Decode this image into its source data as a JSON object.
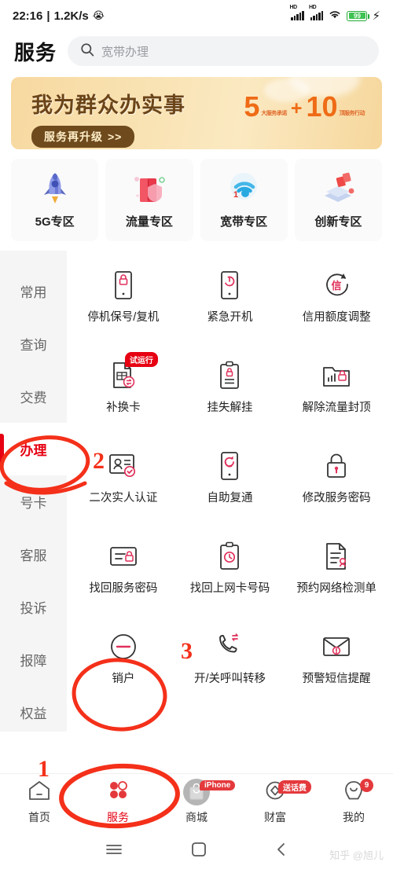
{
  "status_bar": {
    "time": "22:16",
    "separator": "|",
    "net_speed": "1.2K/s",
    "alarm_icon": "alarm-emoji-icon",
    "signal_label": "HD",
    "battery_percent": "99",
    "wifi_icon": "wifi-icon",
    "charging_icon": "lightning-bolt-icon"
  },
  "header": {
    "title": "服务",
    "search": {
      "placeholder": "宽带办理",
      "icon": "search-icon"
    }
  },
  "banner": {
    "title": "我为群众办实事",
    "button_label": "服务再升级",
    "button_arrow": ">>",
    "num_left": "5",
    "plus": "+",
    "num_right": "10",
    "sub_left": "大服务承诺",
    "sub_right": "顶服务行动"
  },
  "zones": [
    {
      "label": "5G专区",
      "icon": "rocket-icon"
    },
    {
      "label": "流量专区",
      "icon": "data-package-icon"
    },
    {
      "label": "宽带专区",
      "icon": "wifi-broadband-icon"
    },
    {
      "label": "创新专区",
      "icon": "innovation-layers-icon"
    }
  ],
  "sidebar": {
    "items": [
      {
        "label": "常用",
        "active": false
      },
      {
        "label": "查询",
        "active": false
      },
      {
        "label": "交费",
        "active": false
      },
      {
        "label": "办理",
        "active": true
      },
      {
        "label": "号卡",
        "active": false
      },
      {
        "label": "客服",
        "active": false
      },
      {
        "label": "投诉",
        "active": false
      },
      {
        "label": "报障",
        "active": false
      },
      {
        "label": "权益",
        "active": false
      }
    ]
  },
  "grid": {
    "items": [
      {
        "label": "停机保号/复机",
        "icon": "phone-lock-icon",
        "badge": ""
      },
      {
        "label": "紧急开机",
        "icon": "phone-power-icon",
        "badge": ""
      },
      {
        "label": "信用额度调整",
        "icon": "credit-refresh-icon",
        "badge": ""
      },
      {
        "label": "补换卡",
        "icon": "sim-swap-icon",
        "badge": "试运行"
      },
      {
        "label": "挂失解挂",
        "icon": "clipboard-lock-icon",
        "badge": ""
      },
      {
        "label": "解除流量封顶",
        "icon": "data-cap-lock-icon",
        "badge": ""
      },
      {
        "label": "二次实人认证",
        "icon": "id-verify-icon",
        "badge": ""
      },
      {
        "label": "自助复通",
        "icon": "phone-reconnect-icon",
        "badge": ""
      },
      {
        "label": "修改服务密码",
        "icon": "padlock-key-icon",
        "badge": ""
      },
      {
        "label": "找回服务密码",
        "icon": "card-lock-icon",
        "badge": ""
      },
      {
        "label": "找回上网卡号码",
        "icon": "clipboard-clock-icon",
        "badge": ""
      },
      {
        "label": "预约网络检测单",
        "icon": "document-user-icon",
        "badge": ""
      },
      {
        "label": "销户",
        "icon": "minus-circle-icon",
        "badge": ""
      },
      {
        "label": "开/关呼叫转移",
        "icon": "call-forward-icon",
        "badge": ""
      },
      {
        "label": "预警短信提醒",
        "icon": "envelope-alert-icon",
        "badge": ""
      }
    ]
  },
  "tabbar": {
    "items": [
      {
        "label": "首页",
        "icon": "home-icon",
        "badge": "",
        "active": false
      },
      {
        "label": "服务",
        "icon": "service-clover-icon",
        "badge": "",
        "active": true
      },
      {
        "label": "商城",
        "icon": "shop-bag-icon",
        "badge": "iPhone",
        "active": false
      },
      {
        "label": "财富",
        "icon": "wealth-diamond-icon",
        "badge": "送话费",
        "active": false
      },
      {
        "label": "我的",
        "icon": "profile-icon",
        "badge": "9",
        "active": false
      }
    ]
  },
  "android_nav": {
    "menu_icon": "menu-icon",
    "home_icon": "square-home-icon",
    "back_icon": "back-chevron-icon"
  },
  "watermark": "知乎 @旭儿",
  "annotations": {
    "step1": "1",
    "step2": "2",
    "step3": "3"
  },
  "colors": {
    "brand_red": "#e60012",
    "annotation_red": "#f4301a",
    "banner_gold": "#f7d9a0",
    "battery_green": "#3ec252"
  }
}
